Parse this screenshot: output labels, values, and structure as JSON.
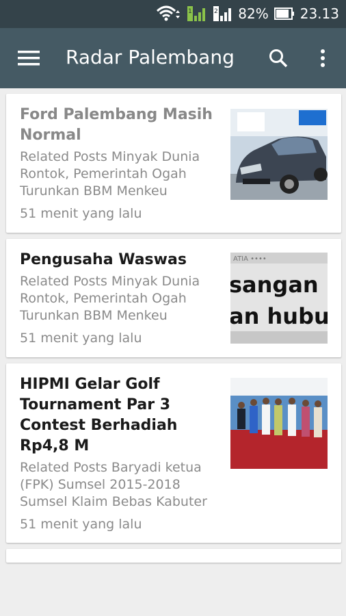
{
  "status": {
    "battery": "82%",
    "time": "23.13"
  },
  "appbar": {
    "title": "Radar Palembang"
  },
  "articles": [
    {
      "title": "Ford Palembang Masih Normal",
      "excerpt": "Related Posts Minyak Dunia Rontok, Pemerintah Ogah Turunkan BBM Menkeu",
      "time": "51 menit yang lalu",
      "thumb_icon": "car-photo"
    },
    {
      "title": "Pengusaha Waswas",
      "excerpt": "Related Posts Minyak Dunia Rontok, Pemerintah Ogah Turunkan BBM Menkeu",
      "time": "51 menit yang lalu",
      "thumb_text_1": "sangan ikla",
      "thumb_text_2": "an hubungi",
      "thumb_icon": "newspaper-photo"
    },
    {
      "title": "HIPMI Gelar Golf Tournament Par 3 Contest Berhadiah Rp4,8 M",
      "excerpt": "Related Posts Baryadi ketua (FPK) Sumsel 2015-2018 Sumsel Klaim Bebas Kabuter",
      "time": "51 menit yang lalu",
      "thumb_icon": "group-photo"
    }
  ],
  "colors": {
    "appbar": "#455a64",
    "statusbar": "#34434a",
    "background": "#eeeeee"
  }
}
